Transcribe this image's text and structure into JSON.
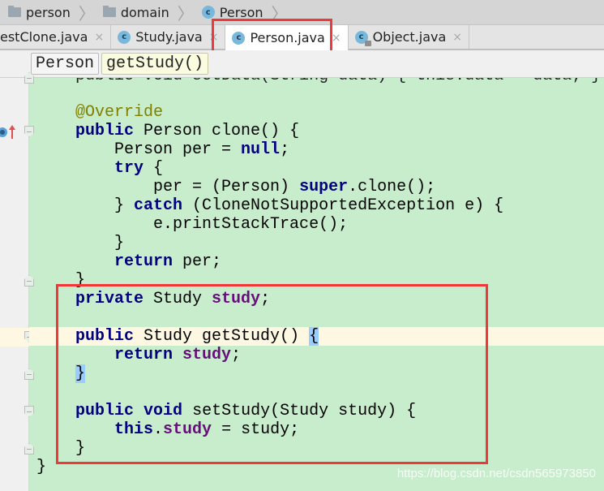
{
  "navbar": {
    "crumbs": [
      {
        "label": "person",
        "icon": "folder-icon"
      },
      {
        "label": "domain",
        "icon": "folder-icon"
      },
      {
        "label": "Person",
        "icon": "class-icon"
      }
    ]
  },
  "tabs": [
    {
      "label": "estClone.java",
      "icon": "",
      "active": false
    },
    {
      "label": "Study.java",
      "icon": "class-icon",
      "active": false
    },
    {
      "label": "Person.java",
      "icon": "class-icon",
      "active": true
    },
    {
      "label": "Object.java",
      "icon": "class-locked-icon",
      "active": false
    }
  ],
  "tab_close_glyph": "×",
  "class_icon_letter": "c",
  "structure_breadcrumb": {
    "class": "Person",
    "method": "getStudy()"
  },
  "code": {
    "partial_top_line": "public void setData(String data) { this.data = data; }",
    "annotation": "@Override",
    "clone_method": {
      "signature_kw": "public",
      "signature_rest": " Person clone() {",
      "l1_type": "Person per = ",
      "l1_null": "null",
      "l1_end": ";",
      "try_kw": "try",
      "try_end": " {",
      "assign_start": "per = (Person) ",
      "super_kw": "super",
      "assign_end": ".clone();",
      "catch_start": "} ",
      "catch_kw": "catch",
      "catch_end": " (CloneNotSupportedException e) {",
      "print": "e.printStackTrace();",
      "close_inner": "}",
      "return_kw": "return",
      "return_end": " per;",
      "close": "}"
    },
    "field_decl": {
      "kw": "private",
      "type": " Study ",
      "name": "study",
      "end": ";"
    },
    "getter": {
      "kw": "public",
      "rest": " Study getStudy() ",
      "open": "{",
      "return_kw": "return",
      "field": "study",
      "end": ";",
      "close": "}"
    },
    "setter": {
      "kw1": "public",
      "kw2": "void",
      "rest": " setStudy(Study study) {",
      "this_kw": "this",
      "dot": ".",
      "field": "study",
      "assign": " = study;",
      "close": "}"
    },
    "class_close": "}"
  },
  "watermark": "https://blog.csdn.net/csdn565973850",
  "colors": {
    "editor_bg": "#c7edcc",
    "keyword": "#000080",
    "field": "#660e7a",
    "annotation": "#808000",
    "highlight_box": "#f03838",
    "caret_row": "#fef8e3"
  }
}
